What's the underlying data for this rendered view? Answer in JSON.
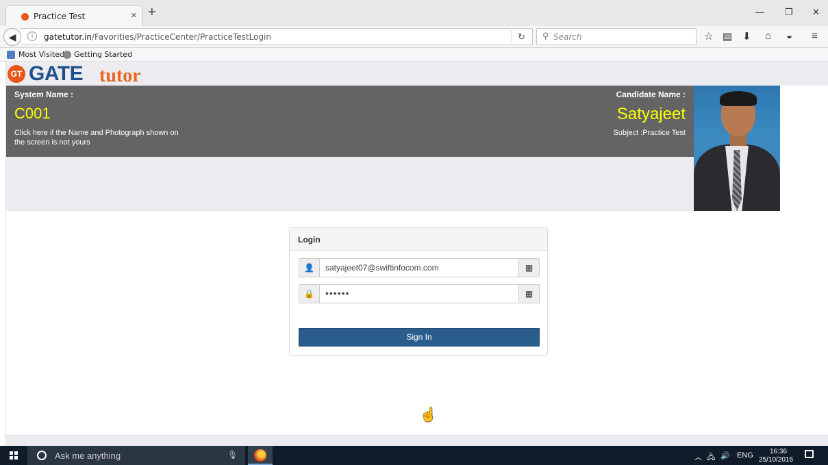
{
  "browser": {
    "tab_title": "Practice Test",
    "tab_close": "×",
    "new_tab": "+",
    "url_host": "gatetutor.in",
    "url_path": "/Favorities/PracticeCenter/PracticeTestLogin",
    "search_placeholder": "Search",
    "bookmarks": [
      {
        "label": "Most Visited"
      },
      {
        "label": "Getting Started"
      }
    ],
    "window_buttons": {
      "minimize": "—",
      "restore": "❐",
      "close": "✕"
    }
  },
  "logo": {
    "badge": "GT",
    "gate": "GATE",
    "tutor": "tutor"
  },
  "header": {
    "system_label": "System Name :",
    "system_value": "C001",
    "system_help": "Click here if the Name and Photograph shown on the screen is not yours",
    "candidate_label": "Candidate Name :",
    "candidate_value": "Satyajeet",
    "subject_label": "Subject",
    "subject_value": "Practice Test"
  },
  "login": {
    "title": "Login",
    "username_value": "satyajeet07@swiftinfocom.com",
    "password_value": "••••••",
    "signin_label": "Sign In"
  },
  "taskbar": {
    "search_placeholder": "Ask me anything",
    "language": "ENG",
    "time": "16:36",
    "date": "25/10/2016"
  },
  "colors": {
    "header_band": "#646464",
    "highlight_text": "#ffff00",
    "button_primary": "#2a5d8c",
    "logo_blue": "#1f4f8a",
    "logo_orange": "#e8661f"
  }
}
